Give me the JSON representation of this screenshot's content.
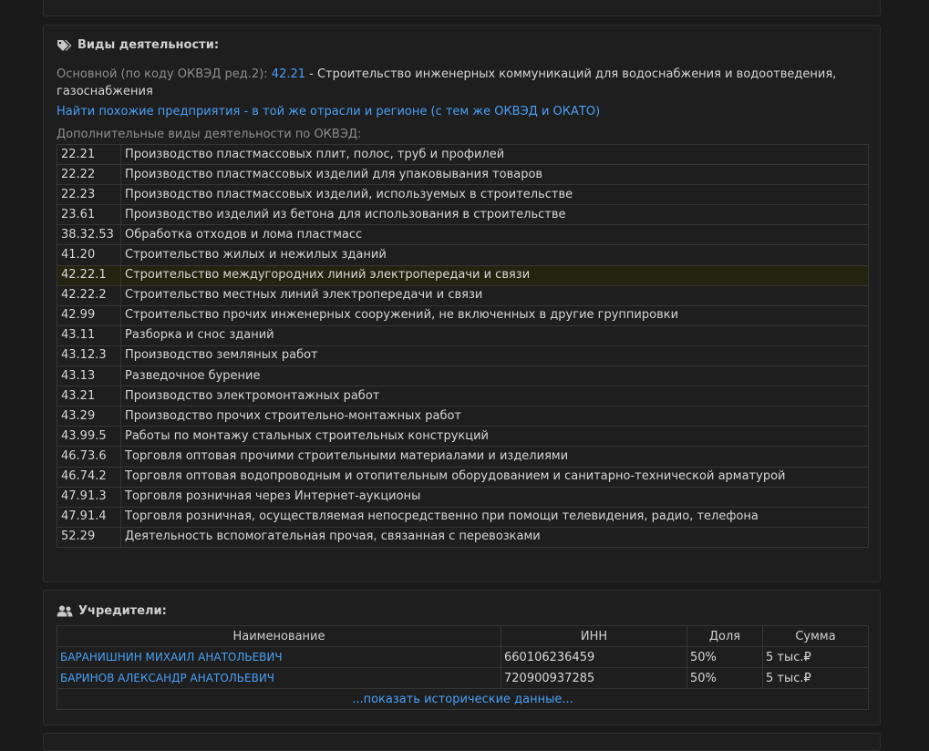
{
  "activity": {
    "title": "Виды деятельности:",
    "primary_prefix": "Основной (по коду ОКВЭД ред.2):",
    "primary_code": "42.21",
    "primary_desc": " - Строительство инженерных коммуникаций для водоснабжения и водоотведения, газоснабжения",
    "similar_link": "Найти похожие предприятия - в той же отрасли и регионе (с тем же ОКВЭД и ОКАТО)",
    "extra_label": "Дополнительные виды деятельности по ОКВЭД:",
    "rows": [
      {
        "code": "22.21",
        "desc": "Производство пластмассовых плит, полос, труб и профилей"
      },
      {
        "code": "22.22",
        "desc": "Производство пластмассовых изделий для упаковывания товаров"
      },
      {
        "code": "22.23",
        "desc": "Производство пластмассовых изделий, используемых в строительстве"
      },
      {
        "code": "23.61",
        "desc": "Производство изделий из бетона для использования в строительстве"
      },
      {
        "code": "38.32.53",
        "desc": "Обработка отходов и лома пластмасс"
      },
      {
        "code": "41.20",
        "desc": "Строительство жилых и нежилых зданий"
      },
      {
        "code": "42.22.1",
        "desc": "Строительство междугородних линий электропередачи и связи"
      },
      {
        "code": "42.22.2",
        "desc": "Строительство местных линий электропередачи и связи"
      },
      {
        "code": "42.99",
        "desc": "Строительство прочих инженерных сооружений, не включенных в другие группировки"
      },
      {
        "code": "43.11",
        "desc": "Разборка и снос зданий"
      },
      {
        "code": "43.12.3",
        "desc": "Производство земляных работ"
      },
      {
        "code": "43.13",
        "desc": "Разведочное бурение"
      },
      {
        "code": "43.21",
        "desc": "Производство электромонтажных работ"
      },
      {
        "code": "43.29",
        "desc": "Производство прочих строительно-монтажных работ"
      },
      {
        "code": "43.99.5",
        "desc": "Работы по монтажу стальных строительных конструкций"
      },
      {
        "code": "46.73.6",
        "desc": "Торговля оптовая прочими строительными материалами и изделиями"
      },
      {
        "code": "46.74.2",
        "desc": "Торговля оптовая водопроводным и отопительным оборудованием и санитарно-технической арматурой"
      },
      {
        "code": "47.91.3",
        "desc": "Торговля розничная через Интернет-аукционы"
      },
      {
        "code": "47.91.4",
        "desc": "Торговля розничная, осуществляемая непосредственно при помощи телевидения, радио, телефона"
      },
      {
        "code": "52.29",
        "desc": "Деятельность вспомогательная прочая, связанная с перевозками"
      }
    ]
  },
  "founders": {
    "title": "Учредители:",
    "headers": {
      "name": "Наименование",
      "inn": "ИНН",
      "share": "Доля",
      "sum": "Сумма"
    },
    "rows": [
      {
        "name": "БАРАНИШНИН МИХАИЛ АНАТОЛЬЕВИЧ",
        "inn": "660106236459",
        "share": "50%",
        "sum": "5 тыс.₽"
      },
      {
        "name": "БАРИНОВ АЛЕКСАНДР АНАТОЛЬЕВИЧ",
        "inn": "720900937285",
        "share": "50%",
        "sum": "5 тыс.₽"
      }
    ],
    "show_history": "...показать исторические данные..."
  },
  "colors": {
    "background": "#1a1a1a",
    "panel": "#1e1e1e",
    "link": "#4a9ff5",
    "highlight_row": "#24230f"
  }
}
